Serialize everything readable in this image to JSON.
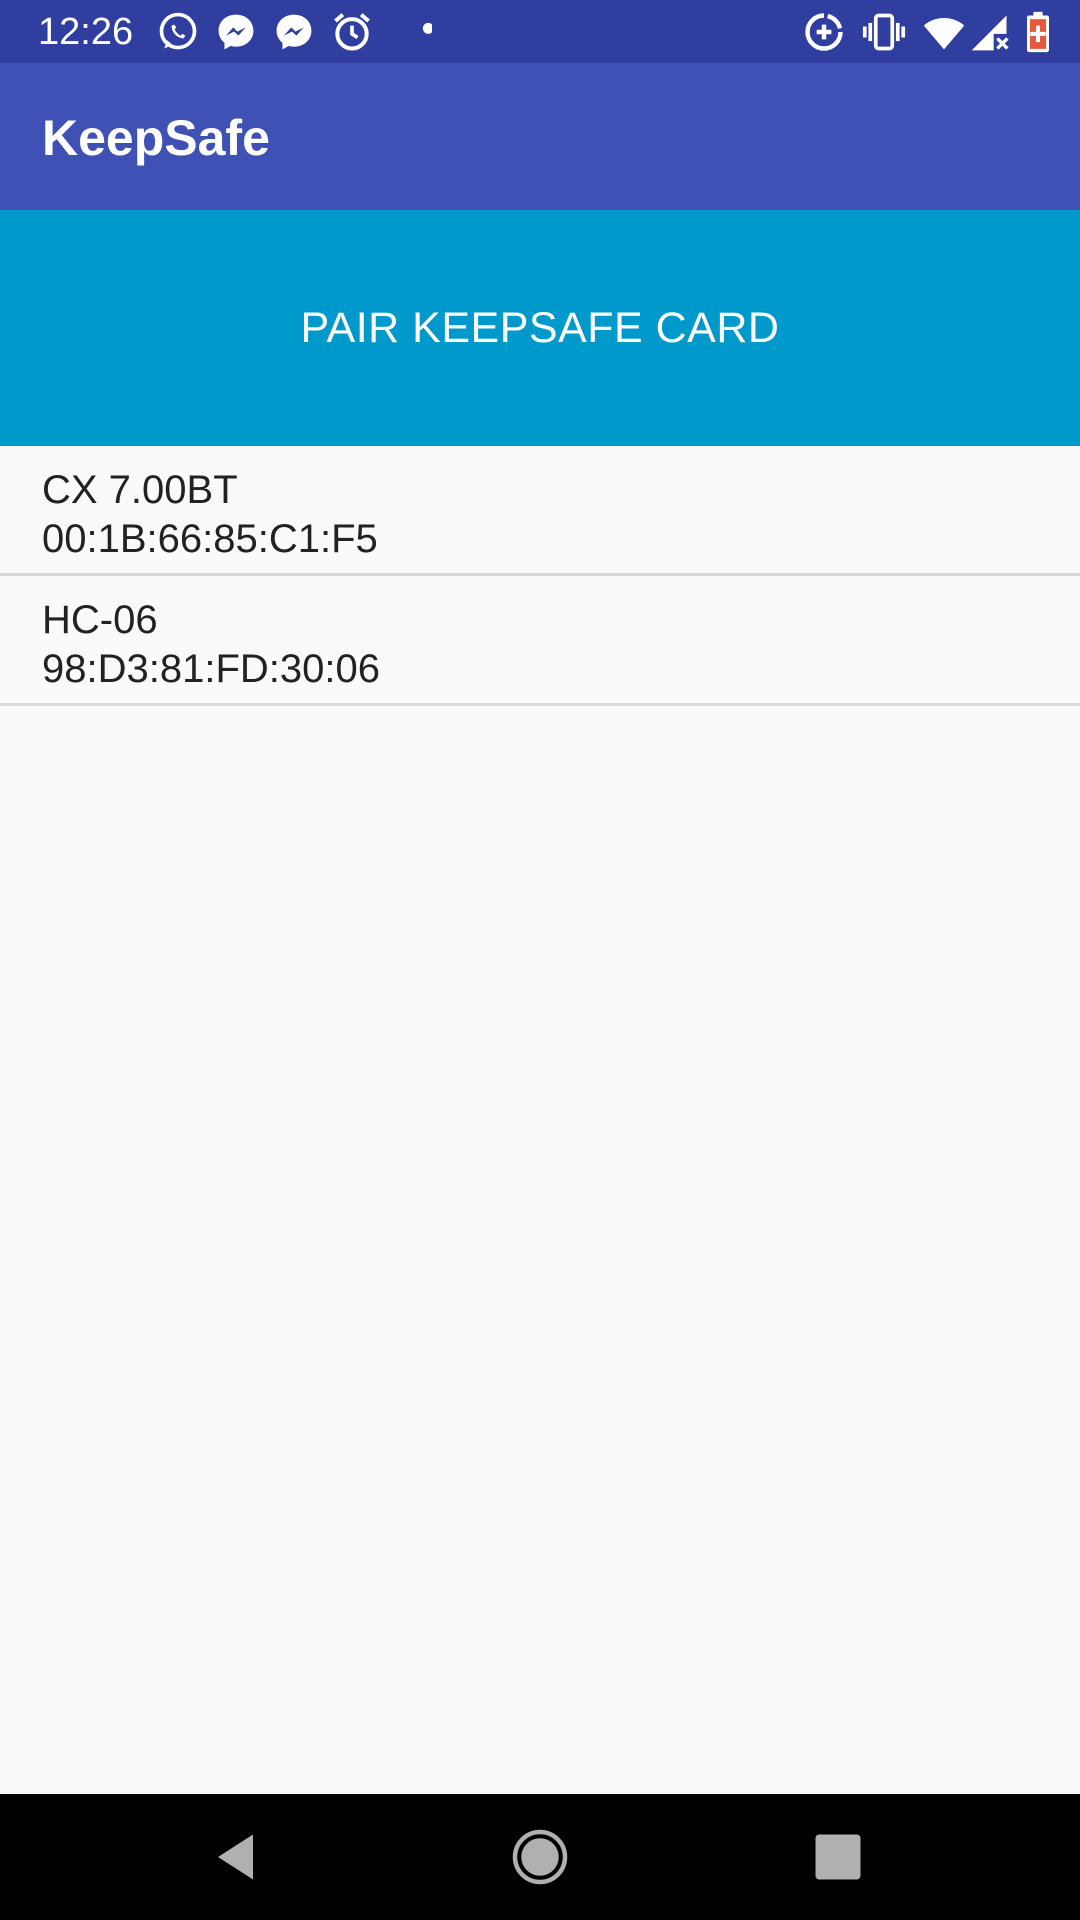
{
  "status_bar": {
    "time": "12:26",
    "left_icons": [
      "whatsapp-icon",
      "messenger-icon",
      "messenger-icon",
      "alarm-icon",
      "dot-icon"
    ],
    "right_icons": [
      "data-saver-icon",
      "vibrate-icon",
      "wifi-icon",
      "signal-icon",
      "battery-charging-icon"
    ],
    "background_color": "#303f9f"
  },
  "app_bar": {
    "title": "KeepSafe",
    "background_color": "#3f51b5"
  },
  "pair_button": {
    "label": "PAIR KEEPSAFE CARD",
    "background_color": "#0099cc"
  },
  "devices": [
    {
      "name": "CX 7.00BT",
      "address": "00:1B:66:85:C1:F5"
    },
    {
      "name": "HC-06",
      "address": "98:D3:81:FD:30:06"
    }
  ],
  "nav_bar": {
    "buttons": [
      "back-icon",
      "home-icon",
      "recents-icon"
    ]
  }
}
